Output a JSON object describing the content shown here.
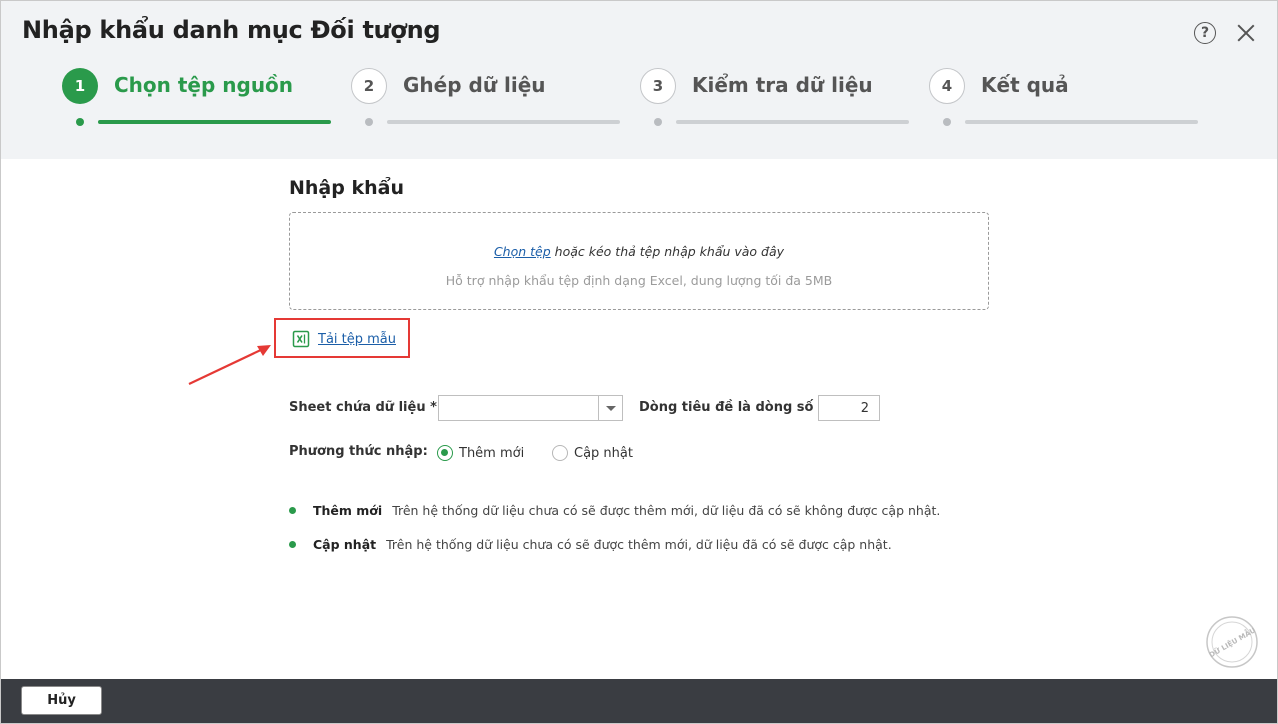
{
  "dialog": {
    "title": "Nhập khẩu danh mục Đối tượng",
    "help_symbol": "?"
  },
  "steps": [
    {
      "number": "1",
      "label": "Chọn tệp nguồn",
      "state": "active"
    },
    {
      "number": "2",
      "label": "Ghép dữ liệu",
      "state": "inactive"
    },
    {
      "number": "3",
      "label": "Kiểm tra dữ liệu",
      "state": "inactive"
    },
    {
      "number": "4",
      "label": "Kết quả",
      "state": "inactive"
    }
  ],
  "import": {
    "section_title": "Nhập khẩu",
    "choose_file_link": "Chọn tệp",
    "drop_text": " hoặc kéo thả tệp nhập khẩu vào đây",
    "support_text": "Hỗ trợ nhập khẩu tệp định dạng Excel, dung lượng tối đa 5MB",
    "download_template": "Tải tệp mẫu"
  },
  "form": {
    "sheet_label": "Sheet chứa dữ liệu *",
    "sheet_value": "",
    "header_row_label": "Dòng tiêu đề là dòng số *",
    "header_row_value": "2",
    "method_label": "Phương thức nhập:",
    "methods": [
      {
        "label": "Thêm mới",
        "checked": true
      },
      {
        "label": "Cập nhật",
        "checked": false
      }
    ]
  },
  "notes": [
    {
      "key": "Thêm mới",
      "text": "Trên hệ thống dữ liệu chưa có sẽ được thêm mới, dữ liệu đã có sẽ không được cập nhật."
    },
    {
      "key": "Cập nhật",
      "text": "Trên hệ thống dữ liệu chưa có sẽ được thêm mới, dữ liệu đã có sẽ được cập nhật."
    }
  ],
  "footer": {
    "cancel_label": "Hủy"
  },
  "watermark_text": "DỮ LIỆU MẪU",
  "colors": {
    "accent": "#2a9a4b",
    "highlight": "#e53935",
    "link": "#1b5ea8",
    "footer_bg": "#3a3d42"
  },
  "icons": {
    "help": "question-circle-icon",
    "close": "close-icon",
    "template": "excel-file-icon",
    "dropdown": "chevron-down-icon"
  }
}
